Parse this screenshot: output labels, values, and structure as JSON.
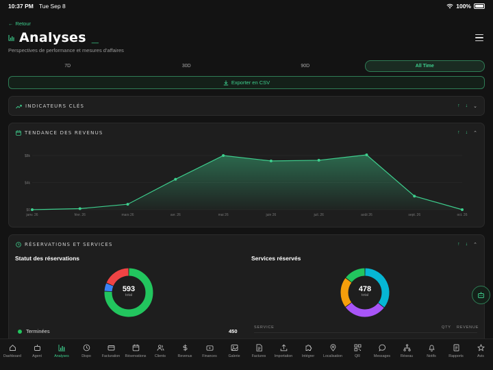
{
  "status": {
    "time": "10:37 PM",
    "date": "Tue Sep 8",
    "battery": "100%"
  },
  "header": {
    "back_label": "Retour",
    "title": "Analyses",
    "cursor": "_",
    "subtitle": "Perspectives de performance et mesures d'affaires"
  },
  "ranges": [
    {
      "label": "7D",
      "active": false
    },
    {
      "label": "30D",
      "active": false
    },
    {
      "label": "90D",
      "active": false
    },
    {
      "label": "All Time",
      "active": true
    }
  ],
  "export_label": "Exporter en CSV",
  "cards": {
    "kpi_title": "Indicateurs clés",
    "revenue_title": "Tendance des revenus",
    "reservations_title": "Réservations et services"
  },
  "chart_data": {
    "type": "area",
    "x": [
      "janv. 26",
      "févr. 26",
      "mars 26",
      "avr. 26",
      "mai 26",
      "juin 26",
      "juil. 26",
      "août 26",
      "sept. 26",
      "oct. 26"
    ],
    "values": [
      0,
      150,
      800,
      4500,
      8000,
      7200,
      7300,
      8100,
      2000,
      0
    ],
    "yticks": [
      "$0",
      "$4k",
      "$8k"
    ],
    "ylim": [
      0,
      8000
    ],
    "grid": true,
    "color": "#3ecf8e"
  },
  "reservations": {
    "status_title": "Statut des réservations",
    "status_total": "593",
    "status_total_label": "total",
    "status_segments": [
      {
        "value": 450,
        "color": "#22c55e"
      },
      {
        "value": 33,
        "color": "#3b82f6"
      },
      {
        "value": 110,
        "color": "#ef4444"
      }
    ],
    "legend": [
      {
        "label": "Terminées",
        "value": "450"
      }
    ],
    "services_title": "Services réservés",
    "services_total": "478",
    "services_total_label": "total",
    "service_segments": [
      {
        "value": 170,
        "color": "#06b6d4"
      },
      {
        "value": 140,
        "color": "#a855f7"
      },
      {
        "value": 98,
        "color": "#f59e0b"
      },
      {
        "value": 70,
        "color": "#22c55e"
      }
    ],
    "table_headers": {
      "service": "Service",
      "qty": "Qty",
      "revenue": "Revenue"
    }
  },
  "tabs": [
    {
      "label": "Dashboard",
      "icon": "home-icon"
    },
    {
      "label": "Agent",
      "icon": "bot-icon"
    },
    {
      "label": "Analyses",
      "icon": "bar-chart-icon",
      "active": true
    },
    {
      "label": "Dispo",
      "icon": "clock-icon"
    },
    {
      "label": "Facturation",
      "icon": "card-icon"
    },
    {
      "label": "Réservations",
      "icon": "calendar-icon"
    },
    {
      "label": "Clients",
      "icon": "users-icon"
    },
    {
      "label": "Revenus",
      "icon": "dollar-icon"
    },
    {
      "label": "Finances",
      "icon": "wallet-icon"
    },
    {
      "label": "Galerie",
      "icon": "image-icon"
    },
    {
      "label": "Factures",
      "icon": "file-icon"
    },
    {
      "label": "Importation",
      "icon": "upload-icon"
    },
    {
      "label": "Intégrer",
      "icon": "puzzle-icon"
    },
    {
      "label": "Localisation",
      "icon": "pin-icon"
    },
    {
      "label": "QR",
      "icon": "qr-icon"
    },
    {
      "label": "Messages",
      "icon": "message-icon"
    },
    {
      "label": "Réseau",
      "icon": "network-icon"
    },
    {
      "label": "Notifs",
      "icon": "bell-icon"
    },
    {
      "label": "Rapports",
      "icon": "report-icon"
    },
    {
      "label": "Avis",
      "icon": "star-icon"
    }
  ]
}
